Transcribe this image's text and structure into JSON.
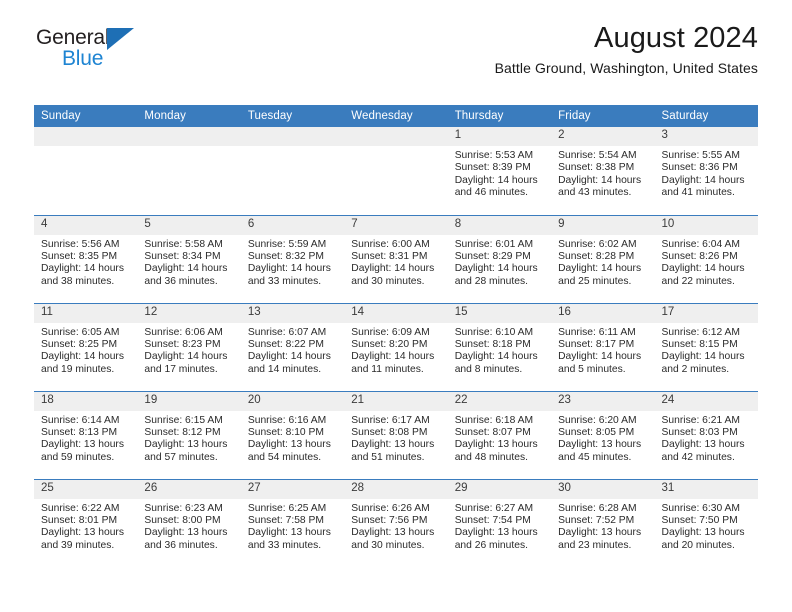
{
  "brand": {
    "word_one": "General",
    "word_two": "Blue",
    "triangle_color": "#1e6fb5",
    "blue_text_color": "#1e84d2"
  },
  "header": {
    "title": "August 2024",
    "subtitle": "Battle Ground, Washington, United States",
    "header_bg": "#3a7cbe",
    "band_bg": "#efefef"
  },
  "weekdays": [
    "Sunday",
    "Monday",
    "Tuesday",
    "Wednesday",
    "Thursday",
    "Friday",
    "Saturday"
  ],
  "weeks": [
    [
      {
        "day": "",
        "sunrise": "",
        "sunset": "",
        "daylight1": "",
        "daylight2": ""
      },
      {
        "day": "",
        "sunrise": "",
        "sunset": "",
        "daylight1": "",
        "daylight2": ""
      },
      {
        "day": "",
        "sunrise": "",
        "sunset": "",
        "daylight1": "",
        "daylight2": ""
      },
      {
        "day": "",
        "sunrise": "",
        "sunset": "",
        "daylight1": "",
        "daylight2": ""
      },
      {
        "day": "1",
        "sunrise": "Sunrise: 5:53 AM",
        "sunset": "Sunset: 8:39 PM",
        "daylight1": "Daylight: 14 hours",
        "daylight2": "and 46 minutes."
      },
      {
        "day": "2",
        "sunrise": "Sunrise: 5:54 AM",
        "sunset": "Sunset: 8:38 PM",
        "daylight1": "Daylight: 14 hours",
        "daylight2": "and 43 minutes."
      },
      {
        "day": "3",
        "sunrise": "Sunrise: 5:55 AM",
        "sunset": "Sunset: 8:36 PM",
        "daylight1": "Daylight: 14 hours",
        "daylight2": "and 41 minutes."
      }
    ],
    [
      {
        "day": "4",
        "sunrise": "Sunrise: 5:56 AM",
        "sunset": "Sunset: 8:35 PM",
        "daylight1": "Daylight: 14 hours",
        "daylight2": "and 38 minutes."
      },
      {
        "day": "5",
        "sunrise": "Sunrise: 5:58 AM",
        "sunset": "Sunset: 8:34 PM",
        "daylight1": "Daylight: 14 hours",
        "daylight2": "and 36 minutes."
      },
      {
        "day": "6",
        "sunrise": "Sunrise: 5:59 AM",
        "sunset": "Sunset: 8:32 PM",
        "daylight1": "Daylight: 14 hours",
        "daylight2": "and 33 minutes."
      },
      {
        "day": "7",
        "sunrise": "Sunrise: 6:00 AM",
        "sunset": "Sunset: 8:31 PM",
        "daylight1": "Daylight: 14 hours",
        "daylight2": "and 30 minutes."
      },
      {
        "day": "8",
        "sunrise": "Sunrise: 6:01 AM",
        "sunset": "Sunset: 8:29 PM",
        "daylight1": "Daylight: 14 hours",
        "daylight2": "and 28 minutes."
      },
      {
        "day": "9",
        "sunrise": "Sunrise: 6:02 AM",
        "sunset": "Sunset: 8:28 PM",
        "daylight1": "Daylight: 14 hours",
        "daylight2": "and 25 minutes."
      },
      {
        "day": "10",
        "sunrise": "Sunrise: 6:04 AM",
        "sunset": "Sunset: 8:26 PM",
        "daylight1": "Daylight: 14 hours",
        "daylight2": "and 22 minutes."
      }
    ],
    [
      {
        "day": "11",
        "sunrise": "Sunrise: 6:05 AM",
        "sunset": "Sunset: 8:25 PM",
        "daylight1": "Daylight: 14 hours",
        "daylight2": "and 19 minutes."
      },
      {
        "day": "12",
        "sunrise": "Sunrise: 6:06 AM",
        "sunset": "Sunset: 8:23 PM",
        "daylight1": "Daylight: 14 hours",
        "daylight2": "and 17 minutes."
      },
      {
        "day": "13",
        "sunrise": "Sunrise: 6:07 AM",
        "sunset": "Sunset: 8:22 PM",
        "daylight1": "Daylight: 14 hours",
        "daylight2": "and 14 minutes."
      },
      {
        "day": "14",
        "sunrise": "Sunrise: 6:09 AM",
        "sunset": "Sunset: 8:20 PM",
        "daylight1": "Daylight: 14 hours",
        "daylight2": "and 11 minutes."
      },
      {
        "day": "15",
        "sunrise": "Sunrise: 6:10 AM",
        "sunset": "Sunset: 8:18 PM",
        "daylight1": "Daylight: 14 hours",
        "daylight2": "and 8 minutes."
      },
      {
        "day": "16",
        "sunrise": "Sunrise: 6:11 AM",
        "sunset": "Sunset: 8:17 PM",
        "daylight1": "Daylight: 14 hours",
        "daylight2": "and 5 minutes."
      },
      {
        "day": "17",
        "sunrise": "Sunrise: 6:12 AM",
        "sunset": "Sunset: 8:15 PM",
        "daylight1": "Daylight: 14 hours",
        "daylight2": "and 2 minutes."
      }
    ],
    [
      {
        "day": "18",
        "sunrise": "Sunrise: 6:14 AM",
        "sunset": "Sunset: 8:13 PM",
        "daylight1": "Daylight: 13 hours",
        "daylight2": "and 59 minutes."
      },
      {
        "day": "19",
        "sunrise": "Sunrise: 6:15 AM",
        "sunset": "Sunset: 8:12 PM",
        "daylight1": "Daylight: 13 hours",
        "daylight2": "and 57 minutes."
      },
      {
        "day": "20",
        "sunrise": "Sunrise: 6:16 AM",
        "sunset": "Sunset: 8:10 PM",
        "daylight1": "Daylight: 13 hours",
        "daylight2": "and 54 minutes."
      },
      {
        "day": "21",
        "sunrise": "Sunrise: 6:17 AM",
        "sunset": "Sunset: 8:08 PM",
        "daylight1": "Daylight: 13 hours",
        "daylight2": "and 51 minutes."
      },
      {
        "day": "22",
        "sunrise": "Sunrise: 6:18 AM",
        "sunset": "Sunset: 8:07 PM",
        "daylight1": "Daylight: 13 hours",
        "daylight2": "and 48 minutes."
      },
      {
        "day": "23",
        "sunrise": "Sunrise: 6:20 AM",
        "sunset": "Sunset: 8:05 PM",
        "daylight1": "Daylight: 13 hours",
        "daylight2": "and 45 minutes."
      },
      {
        "day": "24",
        "sunrise": "Sunrise: 6:21 AM",
        "sunset": "Sunset: 8:03 PM",
        "daylight1": "Daylight: 13 hours",
        "daylight2": "and 42 minutes."
      }
    ],
    [
      {
        "day": "25",
        "sunrise": "Sunrise: 6:22 AM",
        "sunset": "Sunset: 8:01 PM",
        "daylight1": "Daylight: 13 hours",
        "daylight2": "and 39 minutes."
      },
      {
        "day": "26",
        "sunrise": "Sunrise: 6:23 AM",
        "sunset": "Sunset: 8:00 PM",
        "daylight1": "Daylight: 13 hours",
        "daylight2": "and 36 minutes."
      },
      {
        "day": "27",
        "sunrise": "Sunrise: 6:25 AM",
        "sunset": "Sunset: 7:58 PM",
        "daylight1": "Daylight: 13 hours",
        "daylight2": "and 33 minutes."
      },
      {
        "day": "28",
        "sunrise": "Sunrise: 6:26 AM",
        "sunset": "Sunset: 7:56 PM",
        "daylight1": "Daylight: 13 hours",
        "daylight2": "and 30 minutes."
      },
      {
        "day": "29",
        "sunrise": "Sunrise: 6:27 AM",
        "sunset": "Sunset: 7:54 PM",
        "daylight1": "Daylight: 13 hours",
        "daylight2": "and 26 minutes."
      },
      {
        "day": "30",
        "sunrise": "Sunrise: 6:28 AM",
        "sunset": "Sunset: 7:52 PM",
        "daylight1": "Daylight: 13 hours",
        "daylight2": "and 23 minutes."
      },
      {
        "day": "31",
        "sunrise": "Sunrise: 6:30 AM",
        "sunset": "Sunset: 7:50 PM",
        "daylight1": "Daylight: 13 hours",
        "daylight2": "and 20 minutes."
      }
    ]
  ]
}
